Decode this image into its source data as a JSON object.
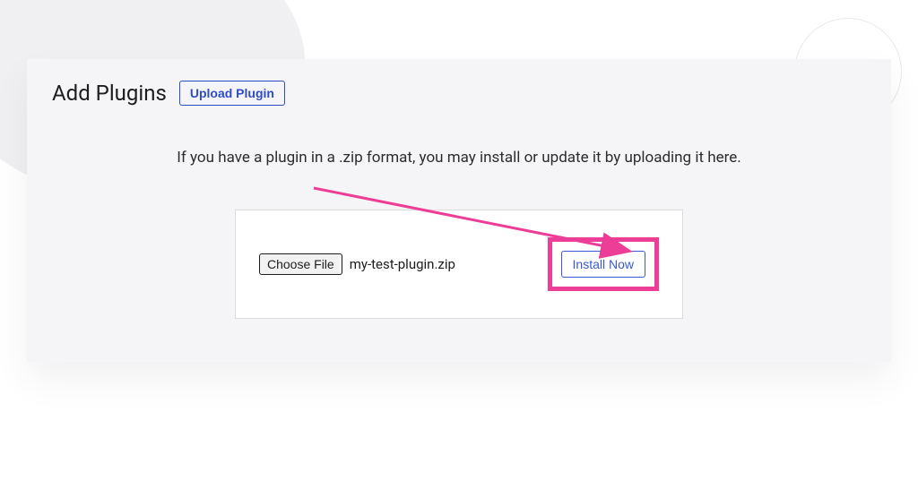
{
  "header": {
    "title": "Add Plugins",
    "upload_button_label": "Upload Plugin"
  },
  "instruction_text": "If you have a plugin in a .zip format, you may install or update it by uploading it here.",
  "file_picker": {
    "choose_file_label": "Choose File",
    "selected_filename": "my-test-plugin.zip"
  },
  "install_button_label": "Install Now",
  "annotation": {
    "highlight_color": "#ec3e96"
  }
}
